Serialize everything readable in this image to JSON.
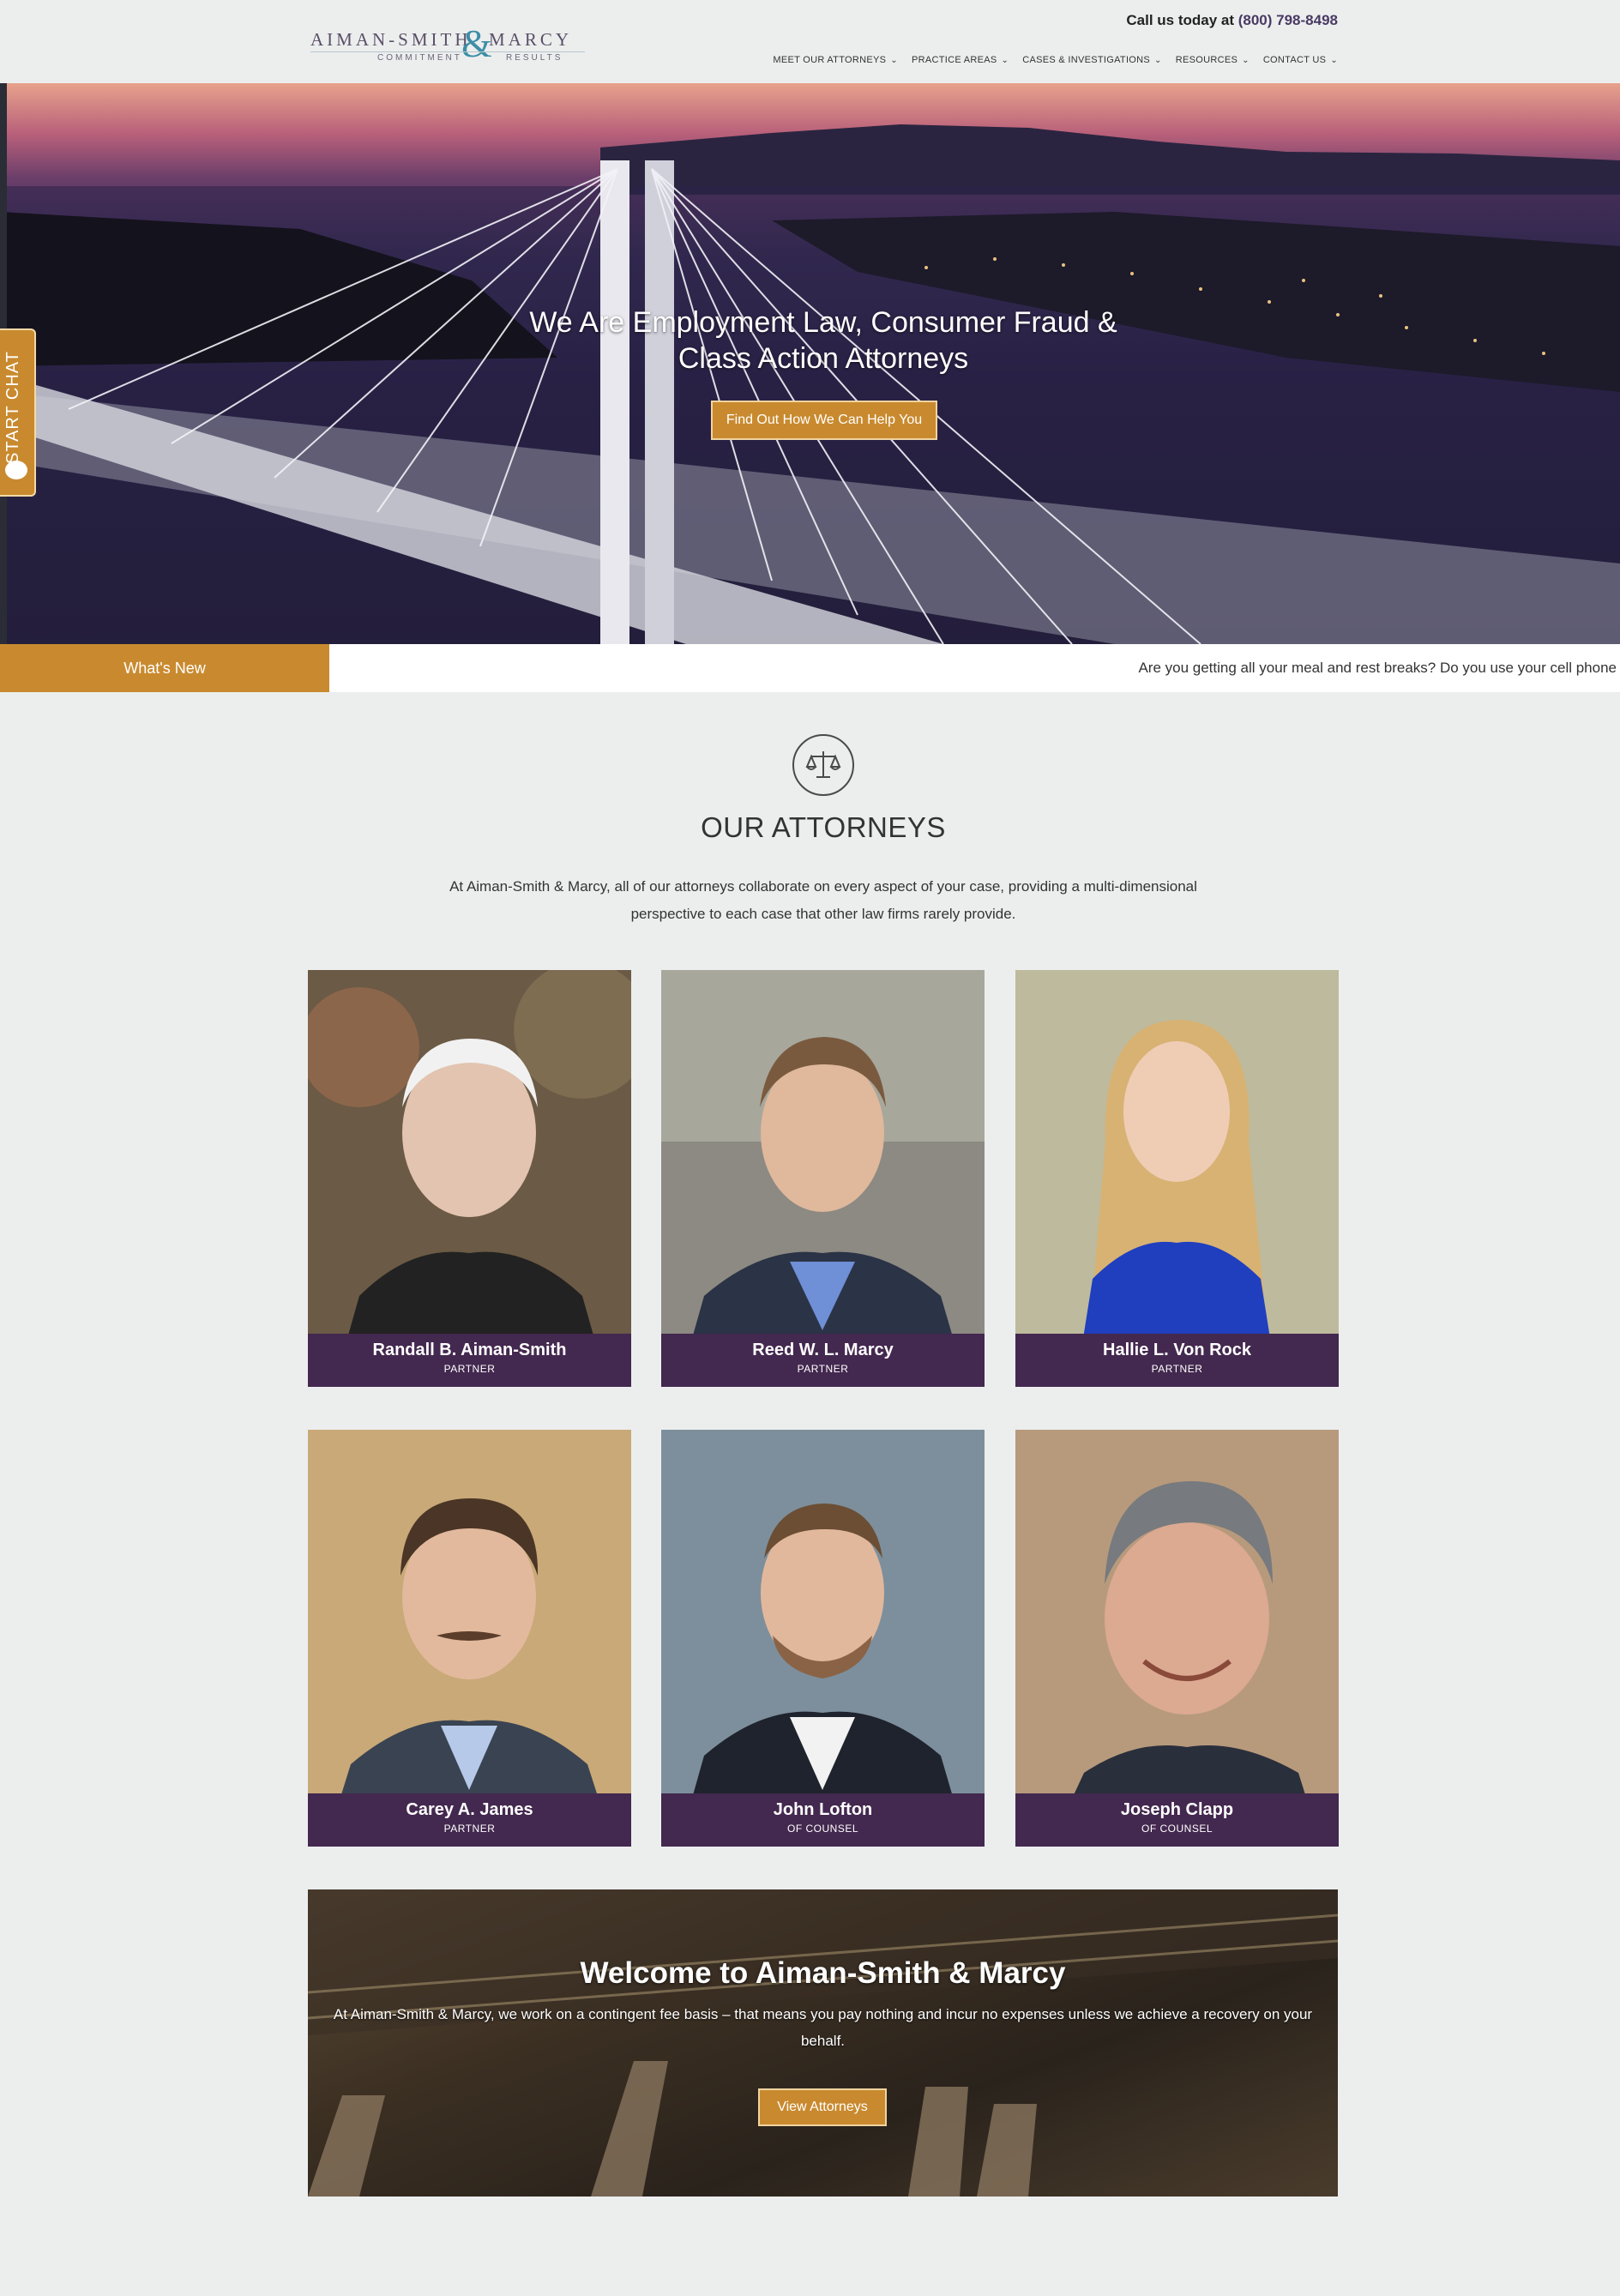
{
  "header": {
    "logo": {
      "left": "AIMAN-SMITH",
      "amp": "&",
      "right": "MARCY",
      "tag_left": "COMMITMENT",
      "tag_right": "RESULTS"
    },
    "call_label": "Call us today at",
    "phone": "(800) 798-8498",
    "nav": [
      {
        "label": "MEET OUR ATTORNEYS"
      },
      {
        "label": "PRACTICE AREAS"
      },
      {
        "label": "CASES & INVESTIGATIONS"
      },
      {
        "label": "RESOURCES"
      },
      {
        "label": "CONTACT US"
      }
    ]
  },
  "hero": {
    "title_line1": "We Are Employment Law, Consumer Fraud &",
    "title_line2": "Class Action Attorneys",
    "cta": "Find Out How We Can Help You"
  },
  "chat": {
    "label": "START CHAT"
  },
  "ticker": {
    "label": "What's New",
    "message": "Are you getting all your meal and rest breaks? Do you use your cell phone"
  },
  "attorneys": {
    "title": "OUR ATTORNEYS",
    "description": "At Aiman-Smith & Marcy, all of our attorneys collaborate on every aspect of your case, providing a multi-dimensional perspective to each case that other law firms rarely provide.",
    "people": [
      {
        "name": "Randall B. Aiman-Smith",
        "role": "PARTNER"
      },
      {
        "name": "Reed W. L. Marcy",
        "role": "PARTNER"
      },
      {
        "name": "Hallie L. Von Rock",
        "role": "PARTNER"
      },
      {
        "name": "Carey A. James",
        "role": "PARTNER"
      },
      {
        "name": "John Lofton",
        "role": "OF COUNSEL"
      },
      {
        "name": "Joseph Clapp",
        "role": "OF COUNSEL"
      }
    ]
  },
  "welcome": {
    "title": "Welcome to Aiman-Smith & Marcy",
    "text": "At Aiman-Smith & Marcy, we work on a contingent fee basis – that means you pay nothing and incur no expenses unless we achieve a recovery on your behalf.",
    "cta": "View Attorneys"
  },
  "colors": {
    "accent": "#c98a2f",
    "caption": "#43284f",
    "background": "#eceeee"
  }
}
